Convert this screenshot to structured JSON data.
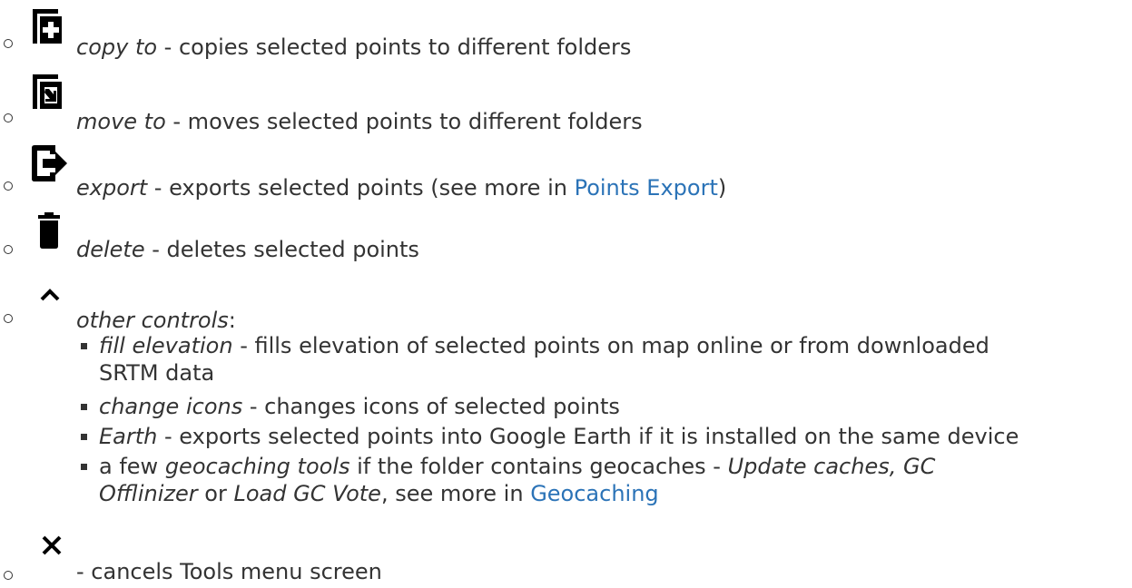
{
  "items": [
    {
      "icon": "copy-to-icon",
      "label": "copy to",
      "desc": " - copies selected points to different folders"
    },
    {
      "icon": "move-to-icon",
      "label": "move to",
      "desc": " - moves selected points to different folders"
    },
    {
      "icon": "export-icon",
      "label": "export",
      "desc_pre": " - exports selected points (see more in ",
      "link": "Points Export",
      "desc_post": ")"
    },
    {
      "icon": "trash-icon",
      "label": "delete",
      "desc": " - deletes selected points"
    },
    {
      "icon": "chevron-up-icon",
      "label": "other controls",
      "desc": ":"
    },
    {
      "icon": "close-icon",
      "desc": " - cancels Tools menu screen"
    }
  ],
  "subitems": [
    {
      "label": "fill elevation",
      "desc_line1": " - fills elevation of selected points on map online or from downloaded",
      "desc_line2": "SRTM data"
    },
    {
      "label": "change icons",
      "desc": " - changes icons of selected points"
    },
    {
      "label": "Earth",
      "desc": " - exports selected points into Google Earth if it is installed on the same device"
    },
    {
      "pre": "a few ",
      "label": "geocaching tools",
      "mid": " if the folder contains geocaches - ",
      "em1": "Update caches, GC",
      "em2": "Offlinizer",
      "or": " or ",
      "em3": "Load GC Vote",
      "post": ", see more in ",
      "link": "Geocaching"
    }
  ],
  "colors": {
    "text": "#333333",
    "link": "#2b73b7",
    "icon": "#000000"
  }
}
